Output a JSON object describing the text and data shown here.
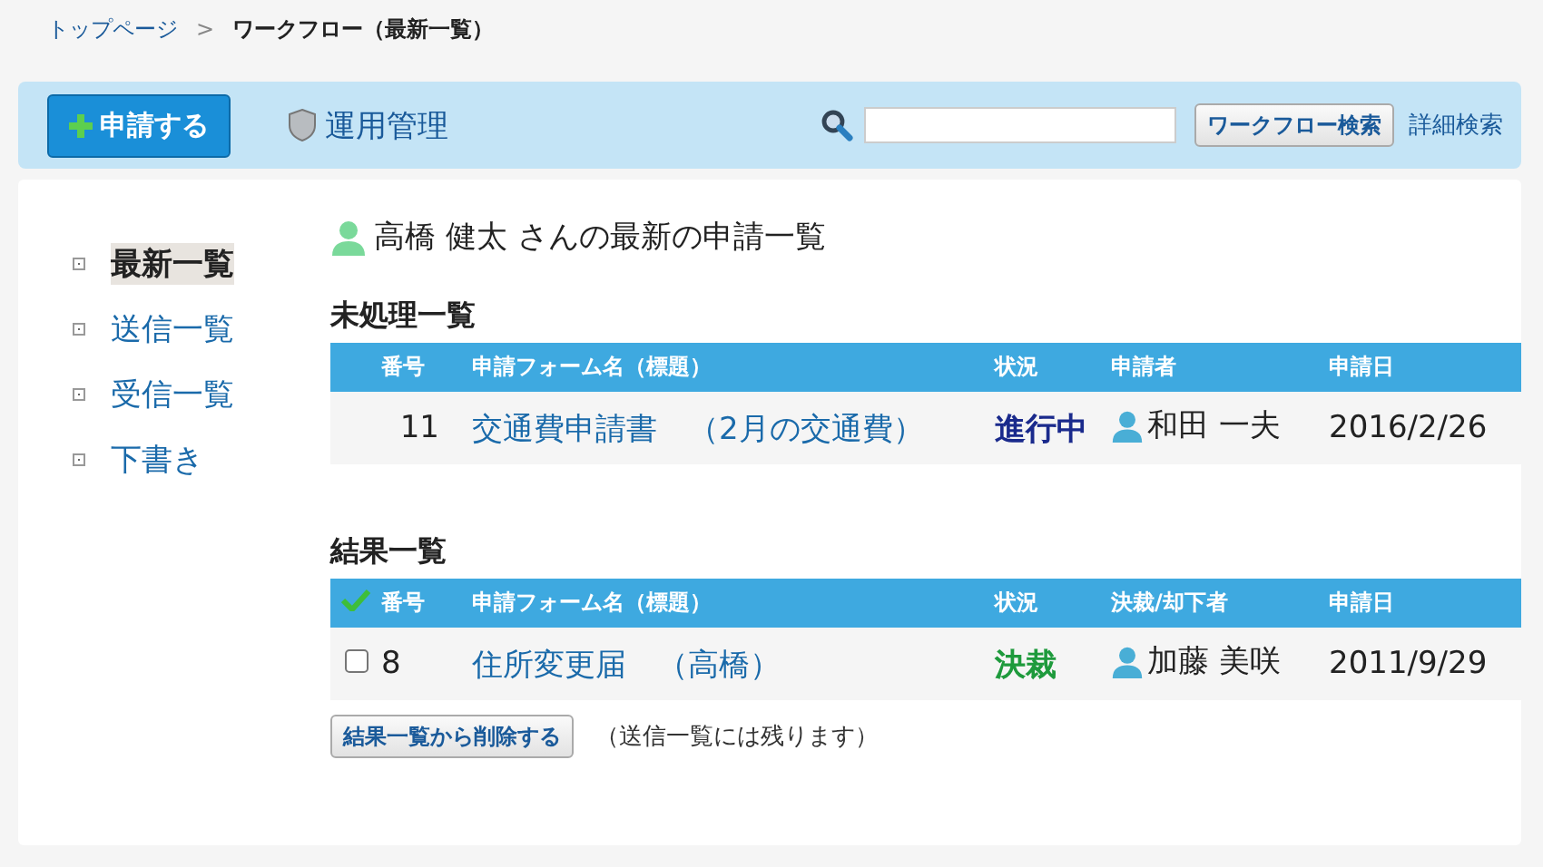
{
  "breadcrumb": {
    "home": "トップページ",
    "separator": ">",
    "current": "ワークフロー（最新一覧）"
  },
  "toolbar": {
    "new_button": "申請する",
    "admin_link": "運用管理",
    "search_button": "ワークフロー検索",
    "advanced_link": "詳細検索"
  },
  "sidebar": {
    "items": [
      {
        "label": "最新一覧",
        "selected": true
      },
      {
        "label": "送信一覧",
        "selected": false
      },
      {
        "label": "受信一覧",
        "selected": false
      },
      {
        "label": "下書き",
        "selected": false
      }
    ]
  },
  "heading": "高橋 健太 さんの最新の申請一覧",
  "pending": {
    "title": "未処理一覧",
    "columns": [
      "番号",
      "申請フォーム名（標題）",
      "状況",
      "申請者",
      "申請日"
    ],
    "rows": [
      {
        "number": "11",
        "form": "交通費申請書　（2月の交通費）",
        "status": "進行中",
        "color": "#1a2a8c",
        "person": "和田 一夫",
        "date": "2016/2/26"
      }
    ]
  },
  "results": {
    "title": "結果一覧",
    "columns": [
      "番号",
      "申請フォーム名（標題）",
      "状況",
      "決裁/却下者",
      "申請日"
    ],
    "rows": [
      {
        "checked": false,
        "number": "8",
        "form": "住所変更届　（高橋）",
        "status": "決裁",
        "color": "#1e9a3c",
        "person": "加藤 美咲",
        "date": "2011/9/29"
      }
    ],
    "delete_button": "結果一覧から削除する",
    "note": "（送信一覧には残ります）"
  }
}
